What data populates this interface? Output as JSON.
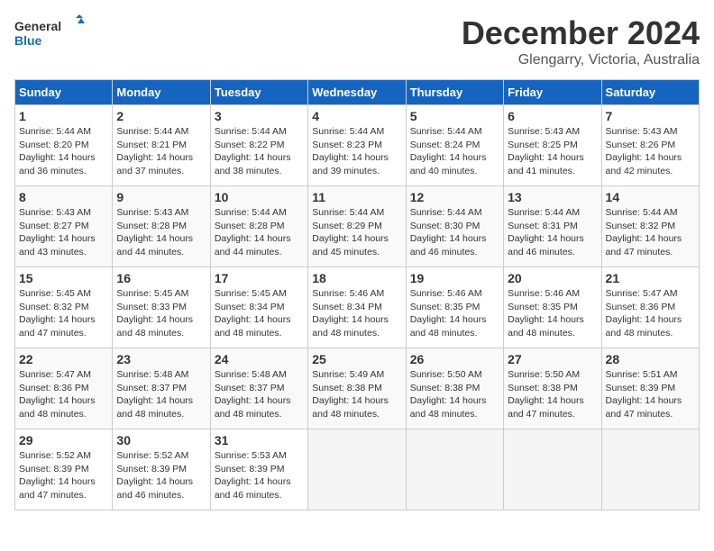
{
  "logo": {
    "line1": "General",
    "line2": "Blue"
  },
  "title": "December 2024",
  "location": "Glengarry, Victoria, Australia",
  "days_of_week": [
    "Sunday",
    "Monday",
    "Tuesday",
    "Wednesday",
    "Thursday",
    "Friday",
    "Saturday"
  ],
  "weeks": [
    [
      {
        "day": "1",
        "sunrise": "5:44 AM",
        "sunset": "8:20 PM",
        "daylight": "14 hours and 36 minutes."
      },
      {
        "day": "2",
        "sunrise": "5:44 AM",
        "sunset": "8:21 PM",
        "daylight": "14 hours and 37 minutes."
      },
      {
        "day": "3",
        "sunrise": "5:44 AM",
        "sunset": "8:22 PM",
        "daylight": "14 hours and 38 minutes."
      },
      {
        "day": "4",
        "sunrise": "5:44 AM",
        "sunset": "8:23 PM",
        "daylight": "14 hours and 39 minutes."
      },
      {
        "day": "5",
        "sunrise": "5:44 AM",
        "sunset": "8:24 PM",
        "daylight": "14 hours and 40 minutes."
      },
      {
        "day": "6",
        "sunrise": "5:43 AM",
        "sunset": "8:25 PM",
        "daylight": "14 hours and 41 minutes."
      },
      {
        "day": "7",
        "sunrise": "5:43 AM",
        "sunset": "8:26 PM",
        "daylight": "14 hours and 42 minutes."
      }
    ],
    [
      {
        "day": "8",
        "sunrise": "5:43 AM",
        "sunset": "8:27 PM",
        "daylight": "14 hours and 43 minutes."
      },
      {
        "day": "9",
        "sunrise": "5:43 AM",
        "sunset": "8:28 PM",
        "daylight": "14 hours and 44 minutes."
      },
      {
        "day": "10",
        "sunrise": "5:44 AM",
        "sunset": "8:28 PM",
        "daylight": "14 hours and 44 minutes."
      },
      {
        "day": "11",
        "sunrise": "5:44 AM",
        "sunset": "8:29 PM",
        "daylight": "14 hours and 45 minutes."
      },
      {
        "day": "12",
        "sunrise": "5:44 AM",
        "sunset": "8:30 PM",
        "daylight": "14 hours and 46 minutes."
      },
      {
        "day": "13",
        "sunrise": "5:44 AM",
        "sunset": "8:31 PM",
        "daylight": "14 hours and 46 minutes."
      },
      {
        "day": "14",
        "sunrise": "5:44 AM",
        "sunset": "8:32 PM",
        "daylight": "14 hours and 47 minutes."
      }
    ],
    [
      {
        "day": "15",
        "sunrise": "5:45 AM",
        "sunset": "8:32 PM",
        "daylight": "14 hours and 47 minutes."
      },
      {
        "day": "16",
        "sunrise": "5:45 AM",
        "sunset": "8:33 PM",
        "daylight": "14 hours and 48 minutes."
      },
      {
        "day": "17",
        "sunrise": "5:45 AM",
        "sunset": "8:34 PM",
        "daylight": "14 hours and 48 minutes."
      },
      {
        "day": "18",
        "sunrise": "5:46 AM",
        "sunset": "8:34 PM",
        "daylight": "14 hours and 48 minutes."
      },
      {
        "day": "19",
        "sunrise": "5:46 AM",
        "sunset": "8:35 PM",
        "daylight": "14 hours and 48 minutes."
      },
      {
        "day": "20",
        "sunrise": "5:46 AM",
        "sunset": "8:35 PM",
        "daylight": "14 hours and 48 minutes."
      },
      {
        "day": "21",
        "sunrise": "5:47 AM",
        "sunset": "8:36 PM",
        "daylight": "14 hours and 48 minutes."
      }
    ],
    [
      {
        "day": "22",
        "sunrise": "5:47 AM",
        "sunset": "8:36 PM",
        "daylight": "14 hours and 48 minutes."
      },
      {
        "day": "23",
        "sunrise": "5:48 AM",
        "sunset": "8:37 PM",
        "daylight": "14 hours and 48 minutes."
      },
      {
        "day": "24",
        "sunrise": "5:48 AM",
        "sunset": "8:37 PM",
        "daylight": "14 hours and 48 minutes."
      },
      {
        "day": "25",
        "sunrise": "5:49 AM",
        "sunset": "8:38 PM",
        "daylight": "14 hours and 48 minutes."
      },
      {
        "day": "26",
        "sunrise": "5:50 AM",
        "sunset": "8:38 PM",
        "daylight": "14 hours and 48 minutes."
      },
      {
        "day": "27",
        "sunrise": "5:50 AM",
        "sunset": "8:38 PM",
        "daylight": "14 hours and 47 minutes."
      },
      {
        "day": "28",
        "sunrise": "5:51 AM",
        "sunset": "8:39 PM",
        "daylight": "14 hours and 47 minutes."
      }
    ],
    [
      {
        "day": "29",
        "sunrise": "5:52 AM",
        "sunset": "8:39 PM",
        "daylight": "14 hours and 47 minutes."
      },
      {
        "day": "30",
        "sunrise": "5:52 AM",
        "sunset": "8:39 PM",
        "daylight": "14 hours and 46 minutes."
      },
      {
        "day": "31",
        "sunrise": "5:53 AM",
        "sunset": "8:39 PM",
        "daylight": "14 hours and 46 minutes."
      },
      null,
      null,
      null,
      null
    ]
  ],
  "labels": {
    "sunrise": "Sunrise:",
    "sunset": "Sunset:",
    "daylight": "Daylight:"
  }
}
